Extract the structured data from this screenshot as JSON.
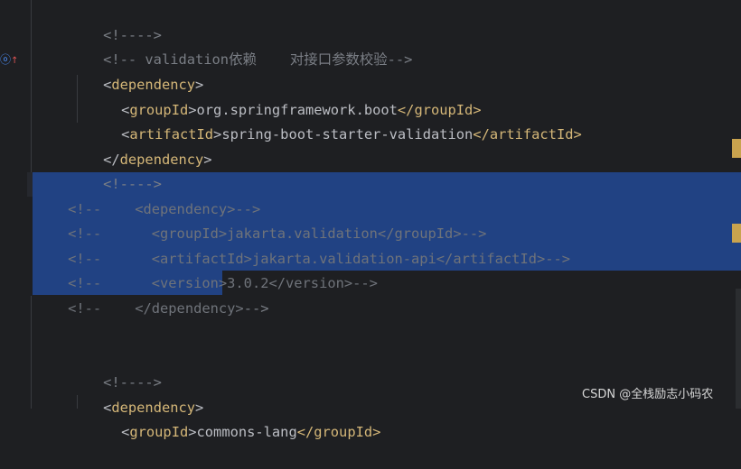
{
  "lines": [
    {
      "cls": "c-comment",
      "text": "<!---->"
    },
    {
      "cls": "c-comment",
      "text": "<!-- validation依赖    对接口参数校验-->"
    },
    {
      "open": "<",
      "tag": "dependency",
      "close": ">"
    },
    {
      "open": "<",
      "tag": "groupId",
      "mid": "org.springframework.boot",
      "etag": "</groupId>"
    },
    {
      "open": "<",
      "tag": "artifactId",
      "mid": "spring-boot-starter-validation",
      "etag": "</artifactId>"
    },
    {
      "open": "</",
      "tag": "dependency",
      "close": ">"
    },
    {
      "cls": "c-comment",
      "text": "<!---->"
    },
    {
      "sel_prefix": "<!--    ",
      "sel_body": "<dependency>-->"
    },
    {
      "sel_prefix": "<!--      ",
      "sel_body": "<groupId>jakarta.validation</groupId>-->"
    },
    {
      "sel_prefix": "<!--      ",
      "sel_body": "<artifactId>jakarta.validation-api</artifactId>-->"
    },
    {
      "sel_prefix": "<!--      ",
      "sel_body": "<version>3.0.2</version>-->"
    },
    {
      "sel_prefix": "<!--    ",
      "sel_body": "</dependency>",
      "tail": "-->"
    },
    {
      "cls": "c-comment",
      "text": "<!---->"
    },
    {
      "open": "<",
      "tag": "dependency",
      "close": ">"
    },
    {
      "open": "<",
      "tag": "groupId",
      "mid": "commons-lang",
      "etag": "</groupId>"
    }
  ],
  "gutter": {
    "icon": "maven-dependency-icon"
  },
  "colors": {
    "selection": "#214283",
    "tag": "#d5b778",
    "comment": "#7a7e85",
    "marker": "#c9a34e"
  },
  "watermark": "CSDN @全栈励志小码农"
}
